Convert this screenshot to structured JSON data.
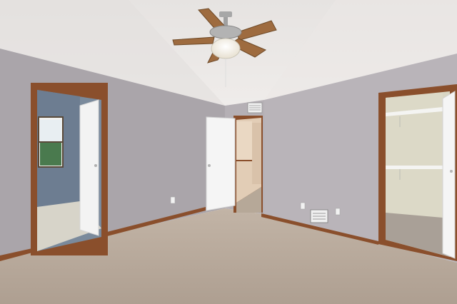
{
  "scene": {
    "description_tags": [],
    "colors": {
      "ceiling": "#e9e6e4",
      "ceiling_shade": "#dcd8d6",
      "wall_left": "#a9a4a9",
      "wall_back": "#b3aeb3",
      "wall_right": "#b8b3b8",
      "carpet": "#b9ab9d",
      "carpet_shade": "#a89a8c",
      "wood_trim": "#8a4f2c",
      "door_white": "#f4f4f4",
      "closet_wall": "#dedbc9",
      "blue_room_wall": "#6f7f93",
      "fan_blade": "#9a6a3e"
    }
  }
}
